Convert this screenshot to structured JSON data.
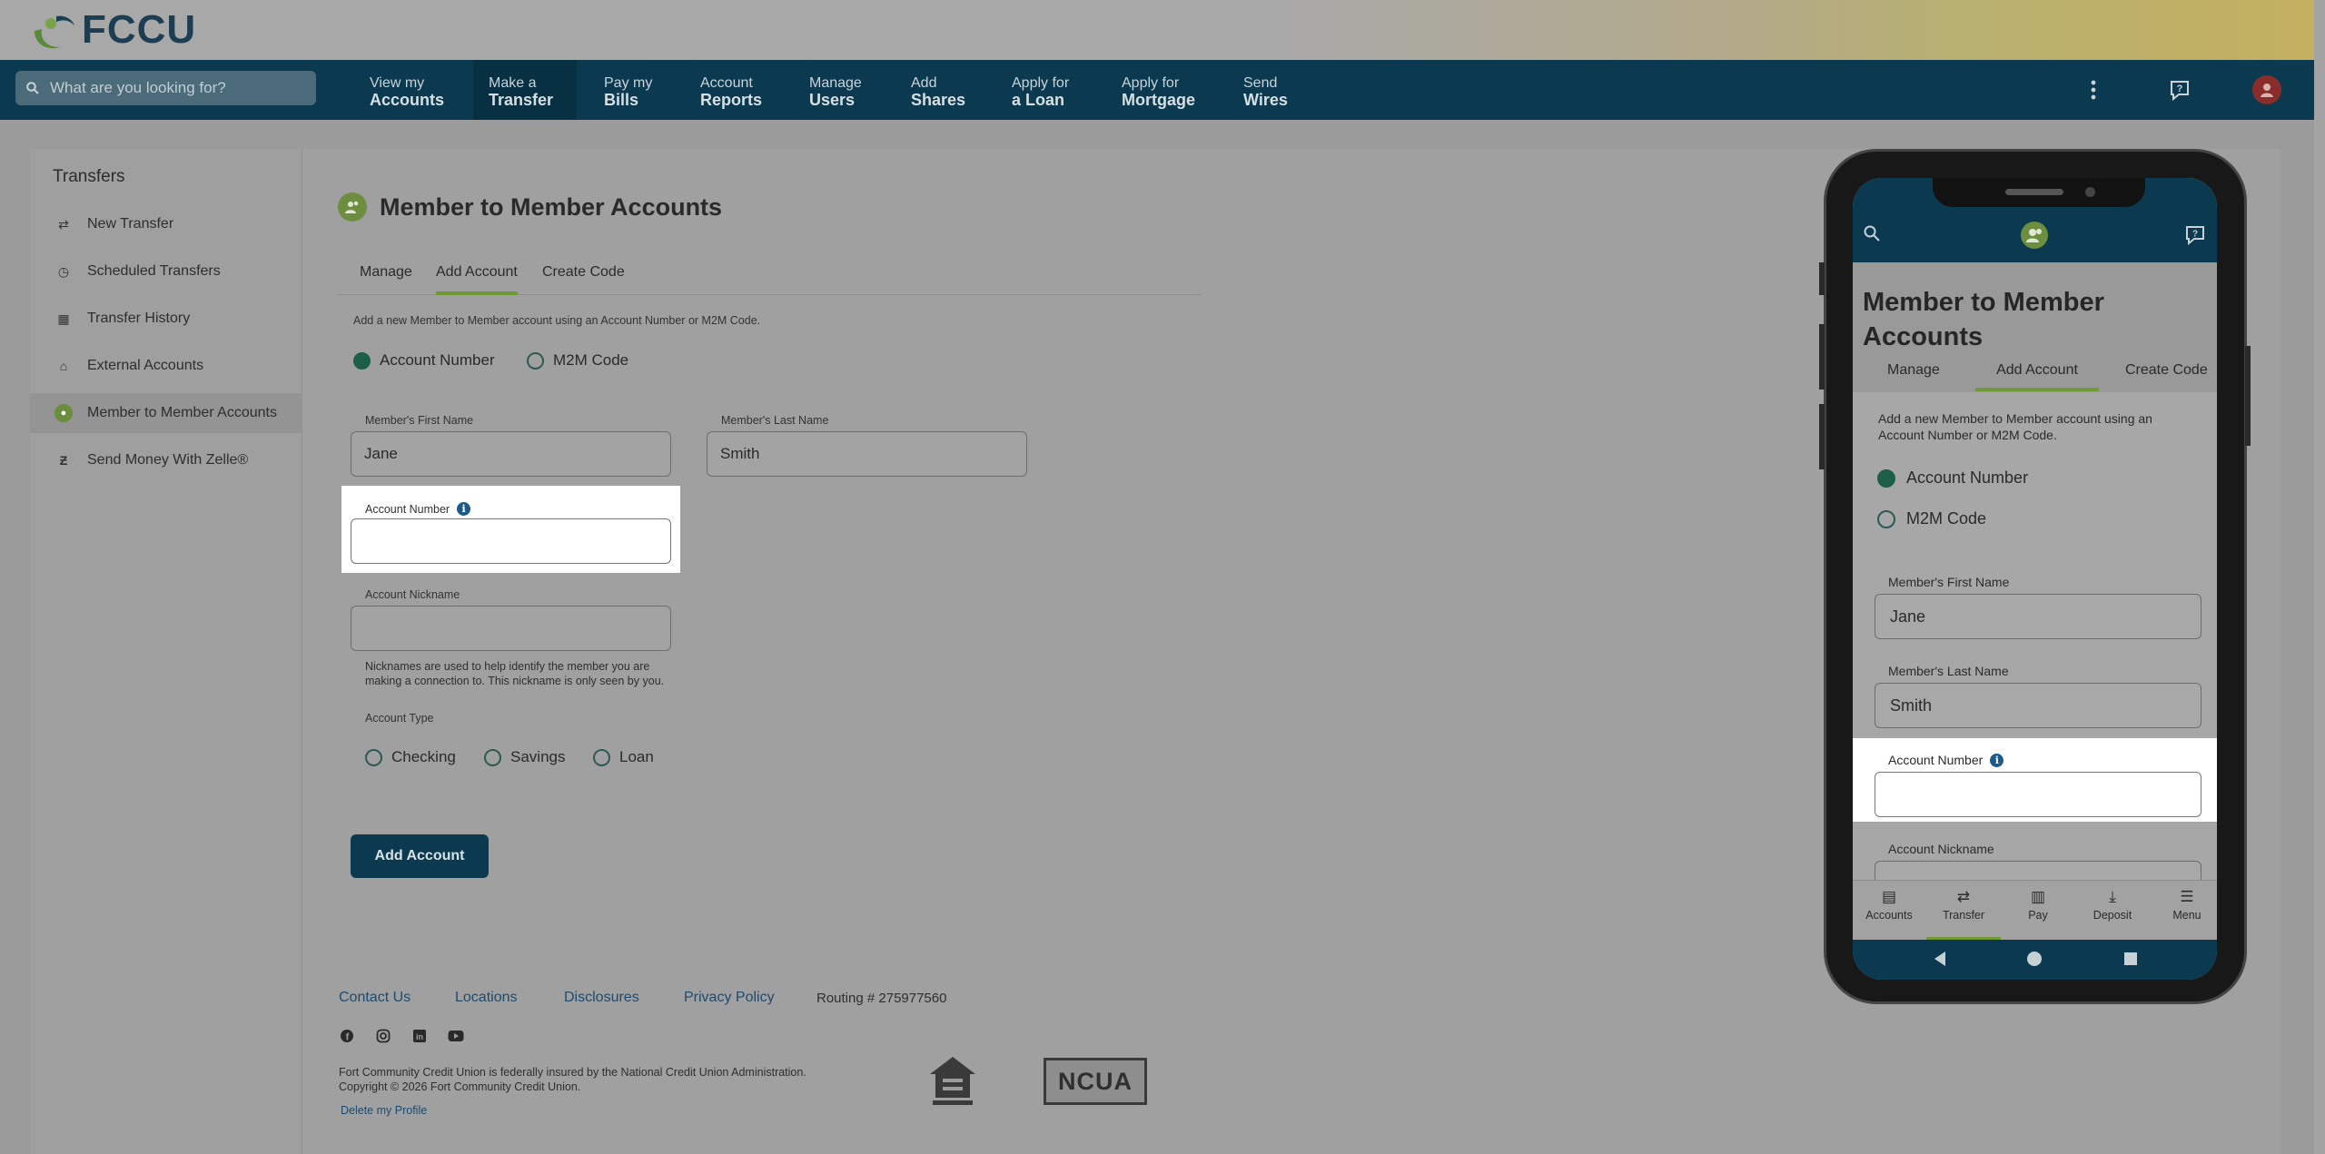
{
  "brand": {
    "logo_text": "FCCU"
  },
  "search": {
    "placeholder": "What are you looking for?"
  },
  "nav": [
    {
      "l1": "View my",
      "l2": "Accounts"
    },
    {
      "l1": "Make a",
      "l2": "Transfer"
    },
    {
      "l1": "Pay my",
      "l2": "Bills"
    },
    {
      "l1": "Account",
      "l2": "Reports"
    },
    {
      "l1": "Manage",
      "l2": "Users"
    },
    {
      "l1": "Add",
      "l2": "Shares"
    },
    {
      "l1": "Apply for",
      "l2": "a Loan"
    },
    {
      "l1": "Apply for",
      "l2": "Mortgage"
    },
    {
      "l1": "Send",
      "l2": "Wires"
    }
  ],
  "sidebar": {
    "title": "Transfers",
    "items": [
      {
        "label": "New Transfer",
        "icon": "arrows-swap-icon"
      },
      {
        "label": "Scheduled Transfers",
        "icon": "clock-icon"
      },
      {
        "label": "Transfer History",
        "icon": "calendar-icon"
      },
      {
        "label": "External Accounts",
        "icon": "bank-icon"
      },
      {
        "label": "Member to Member Accounts",
        "icon": "members-icon"
      },
      {
        "label": "Send Money With Zelle®",
        "icon": "zelle-icon"
      }
    ]
  },
  "main": {
    "title": "Member to Member Accounts",
    "tabs": [
      "Manage",
      "Add Account",
      "Create Code"
    ],
    "help": "Add a new Member to Member account using an Account Number or M2M Code.",
    "mode_options": [
      "Account Number",
      "M2M Code"
    ],
    "first_name_label": "Member's First Name",
    "first_name_value": "Jane",
    "last_name_label": "Member's Last Name",
    "last_name_value": "Smith",
    "account_number_label": "Account Number",
    "account_number_value": "",
    "nickname_label": "Account Nickname",
    "nickname_value": "",
    "nickname_note": "Nicknames are used to help identify the member you are making a connection to. This nickname is only seen by you.",
    "account_type_label": "Account Type",
    "account_types": [
      "Checking",
      "Savings",
      "Loan"
    ],
    "submit_label": "Add Account"
  },
  "footer": {
    "links": [
      "Contact Us",
      "Locations",
      "Disclosures",
      "Privacy Policy"
    ],
    "routing": "Routing # 275977560",
    "legal_1": "Fort Community Credit Union is federally insured by the National Credit Union Administration.",
    "legal_2": "Copyright © 2026 Fort Community Credit Union.",
    "delete_profile": "Delete my Profile",
    "ncua": "NCUA"
  },
  "phone": {
    "title": "Member to Member Accounts",
    "tabs": [
      "Manage",
      "Add Account",
      "Create Code"
    ],
    "help": "Add a new Member to Member account using an Account Number or M2M Code.",
    "mode_options": [
      "Account Number",
      "M2M Code"
    ],
    "first_name_label": "Member's First Name",
    "first_name_value": "Jane",
    "last_name_label": "Member's Last Name",
    "last_name_value": "Smith",
    "account_number_label": "Account Number",
    "nickname_label": "Account Nickname",
    "bottom_nav": [
      "Accounts",
      "Transfer",
      "Pay",
      "Deposit",
      "Menu"
    ]
  }
}
